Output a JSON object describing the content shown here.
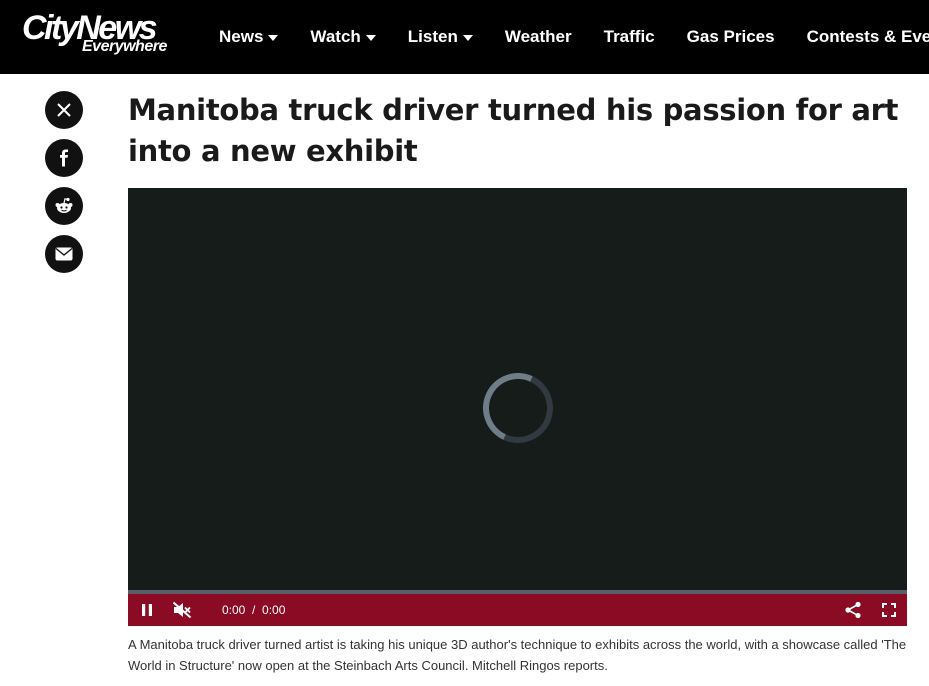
{
  "header": {
    "logo_top": "CityNews",
    "logo_bottom": "Everywhere",
    "nav": [
      {
        "label": "News",
        "has_caret": true
      },
      {
        "label": "Watch",
        "has_caret": true
      },
      {
        "label": "Listen",
        "has_caret": true
      },
      {
        "label": "Weather",
        "has_caret": false
      },
      {
        "label": "Traffic",
        "has_caret": false
      },
      {
        "label": "Gas Prices",
        "has_caret": false
      },
      {
        "label": "Contests & Events",
        "has_caret": false
      }
    ]
  },
  "share": {
    "icons": [
      "x-icon",
      "facebook-icon",
      "reddit-icon",
      "email-icon"
    ]
  },
  "article": {
    "headline": "Manitoba truck driver turned his passion for art into a new exhibit",
    "caption": "A Manitoba truck driver turned artist is taking his unique 3D author's technique to exhibits across the world, with a showcase called 'The World in Structure' now open at the Steinbach Arts Council. Mitchell Ringos reports."
  },
  "player": {
    "current_time": "0:00",
    "separator": "/",
    "duration": "0:00",
    "progress": 0,
    "state": "loading",
    "muted": true
  },
  "colors": {
    "header_bg": "#000000",
    "controls_bg": "#8b0a24",
    "video_bg": "#161c1a",
    "share_bg": "#111111"
  }
}
